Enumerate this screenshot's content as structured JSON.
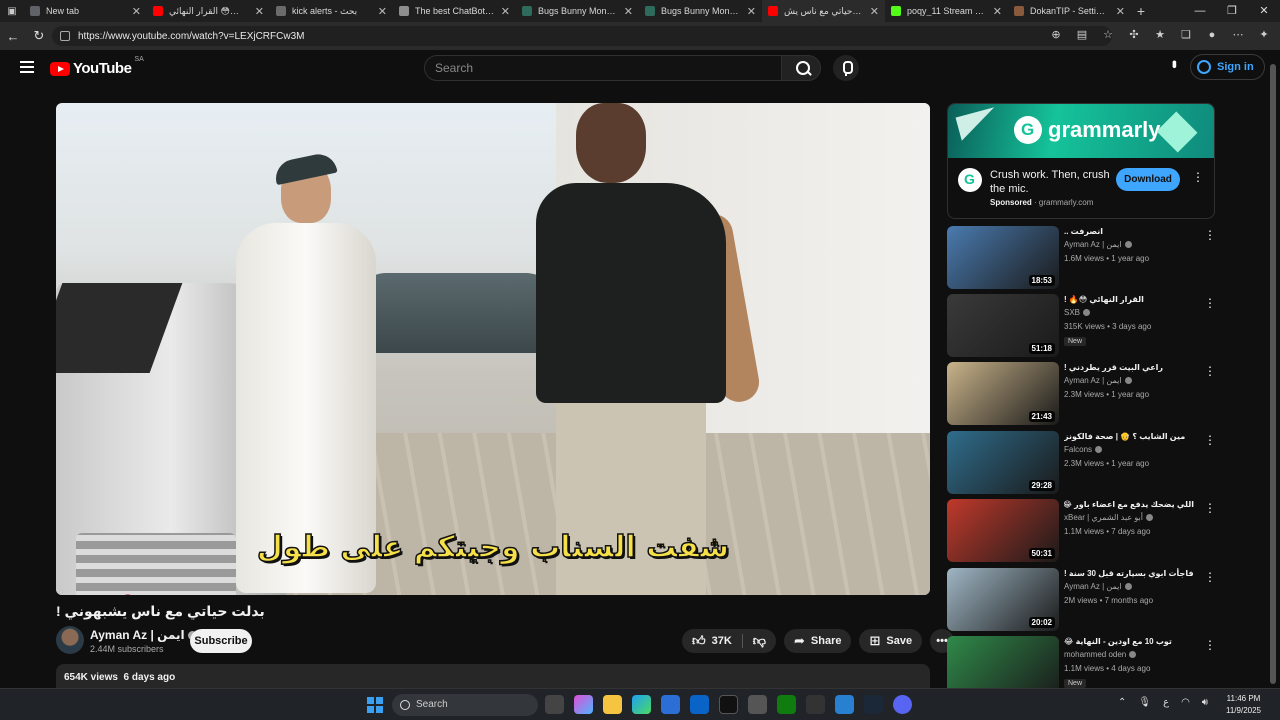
{
  "browser": {
    "tabs": [
      {
        "title": "New tab",
        "color": "#5f6368"
      },
      {
        "title": "القرار النهائي 😳🔥 - !",
        "color": "#ff0000"
      },
      {
        "title": "kick alerts - بحث",
        "color": "#6b6b6b"
      },
      {
        "title": "The best ChatBot and V",
        "color": "#8e8e8e"
      },
      {
        "title": "Bugs Bunny Money GIF",
        "color": "#2e6b5c"
      },
      {
        "title": "Bugs Bunny Money GIF",
        "color": "#2e6b5c"
      },
      {
        "title": "بدلت حياتي مع ناس يش...",
        "color": "#ff0000",
        "active": true
      },
      {
        "title": "poqy_11 Stream - Watc",
        "color": "#53fc18"
      },
      {
        "title": "DokanTIP - Settings",
        "color": "#8a5a3c"
      }
    ],
    "url": "https://www.youtube.com/watch?v=LEXjCRFCw3M",
    "new_tab": "+"
  },
  "youtube": {
    "logo_text": "YouTube",
    "country_code": "SA",
    "search_placeholder": "Search",
    "sign_in": "Sign in"
  },
  "video": {
    "subtitle_text": "شفت السناب وجيتكم على طول",
    "title": "بدلت حياتي مع ناس يشبهوني !",
    "channel": "Ayman Az | ايمن",
    "subscribers": "2.44M subscribers",
    "subscribe_label": "Subscribe",
    "likes": "37K",
    "share_label": "Share",
    "save_label": "Save",
    "views": "654K views",
    "age": "6 days ago"
  },
  "ad": {
    "brand": "grammarly",
    "headline": "Crush work. Then, crush the mic.",
    "sponsored": "Sponsored",
    "domain": "grammarly.com",
    "cta": "Download"
  },
  "recommendations": [
    {
      "title": "انصرفت ..",
      "channel": "Ayman Az | ايمن",
      "views": "1.6M views",
      "age": "1 year ago",
      "duration": "18:53",
      "badge": "",
      "thumb": "#4a7bb0"
    },
    {
      "title": "القرار النهائي 😳🔥 !",
      "channel": "SXB",
      "views": "315K views",
      "age": "3 days ago",
      "duration": "51:18",
      "badge": "New",
      "thumb": "#3a3a3a"
    },
    {
      "title": "راعي البيت قرر يطردني !",
      "channel": "Ayman Az | ايمن",
      "views": "2.3M views",
      "age": "1 year ago",
      "duration": "21:43",
      "badge": "",
      "thumb": "#c9b38a"
    },
    {
      "title": "مين الشايب ؟ 👴 | صحة فالكونز",
      "channel": "Falcons",
      "views": "2.3M views",
      "age": "1 year ago",
      "duration": "29:28",
      "badge": "",
      "thumb": "#2f6d8c"
    },
    {
      "title": "اللي يضحك يدفع مع اعضاء باور 😂💰",
      "channel": "xBear | أبو عبد الشمري",
      "views": "1.1M views",
      "age": "7 days ago",
      "duration": "50:31",
      "badge": "",
      "thumb": "#c0392b"
    },
    {
      "title": "فاجأت ابوي بسيارته قبل 30 سنة !",
      "channel": "Ayman Az | ايمن",
      "views": "2M views",
      "age": "7 months ago",
      "duration": "20:02",
      "badge": "",
      "thumb": "#9fb6c4"
    },
    {
      "title": "توب 10 مع اودين - النهاية 😂",
      "channel": "mohammed oden",
      "views": "1.1M views",
      "age": "4 days ago",
      "duration": "",
      "badge": "New",
      "thumb": "#2f8a4a"
    }
  ],
  "taskbar": {
    "search_placeholder": "Search",
    "time": "11:46 PM",
    "date": "11/9/2025",
    "lang": "ع"
  }
}
